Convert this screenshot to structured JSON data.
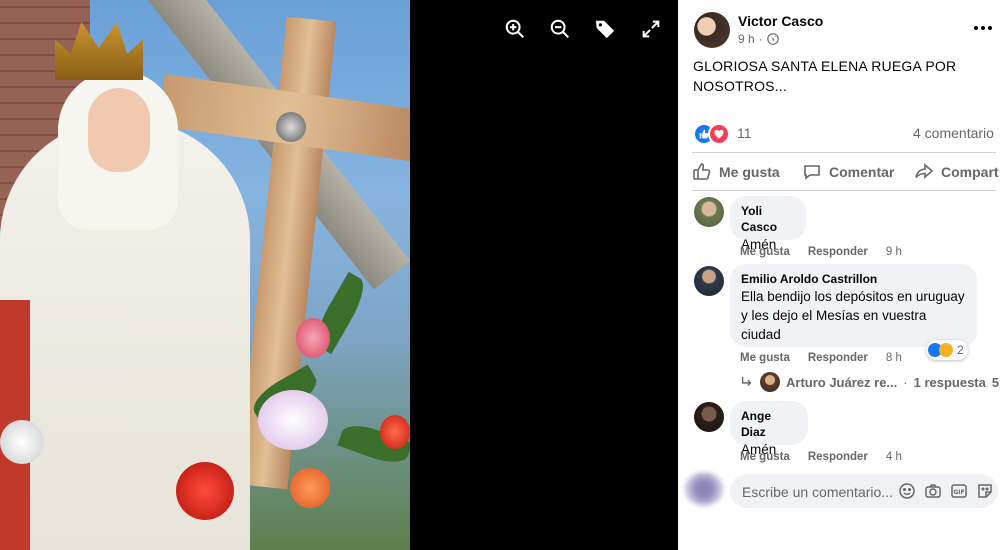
{
  "viewer": {
    "tools": [
      {
        "icon": "zoom-in-icon"
      },
      {
        "icon": "zoom-out-icon"
      },
      {
        "icon": "tag-icon"
      },
      {
        "icon": "fullscreen-icon"
      }
    ]
  },
  "post": {
    "author": "Victor Casco",
    "time": "9 h",
    "audience_icon": "globe-icon",
    "text": "GLORIOSA SANTA ELENA RUEGA POR NOSOTROS...",
    "more_icon": "more-options-icon",
    "reaction_count": "11",
    "comment_count": "4 comentario",
    "actions": {
      "like": "Me gusta",
      "comment": "Comentar",
      "share": "Compart"
    }
  },
  "comments": [
    {
      "author": "Yoli Casco",
      "text": "Amén",
      "like": "Me gusta",
      "reply": "Responder",
      "time": "9 h"
    },
    {
      "author": "Emilio Aroldo Castrillon",
      "text": "Ella bendijo los depósitos en uruguay y les dejo el Mesías en vuestra ciudad",
      "like": "Me gusta",
      "reply": "Responder",
      "time": "8 h",
      "reactions": "2",
      "replies": {
        "author": "Arturo Juárez re...",
        "sep": "·",
        "count": "1 respuesta",
        "trail": "5"
      }
    },
    {
      "author": "Ange Diaz",
      "text": "Amén",
      "like": "Me gusta",
      "reply": "Responder",
      "time": "4 h"
    }
  ],
  "composer": {
    "placeholder": "Escribe un comentario...",
    "icons": [
      "emoji-icon",
      "camera-icon",
      "gif-icon",
      "sticker-icon"
    ]
  },
  "colors": {
    "like_blue": "#1877f2",
    "love_red": "#f33e58",
    "haha_yellow": "#f7b125"
  }
}
